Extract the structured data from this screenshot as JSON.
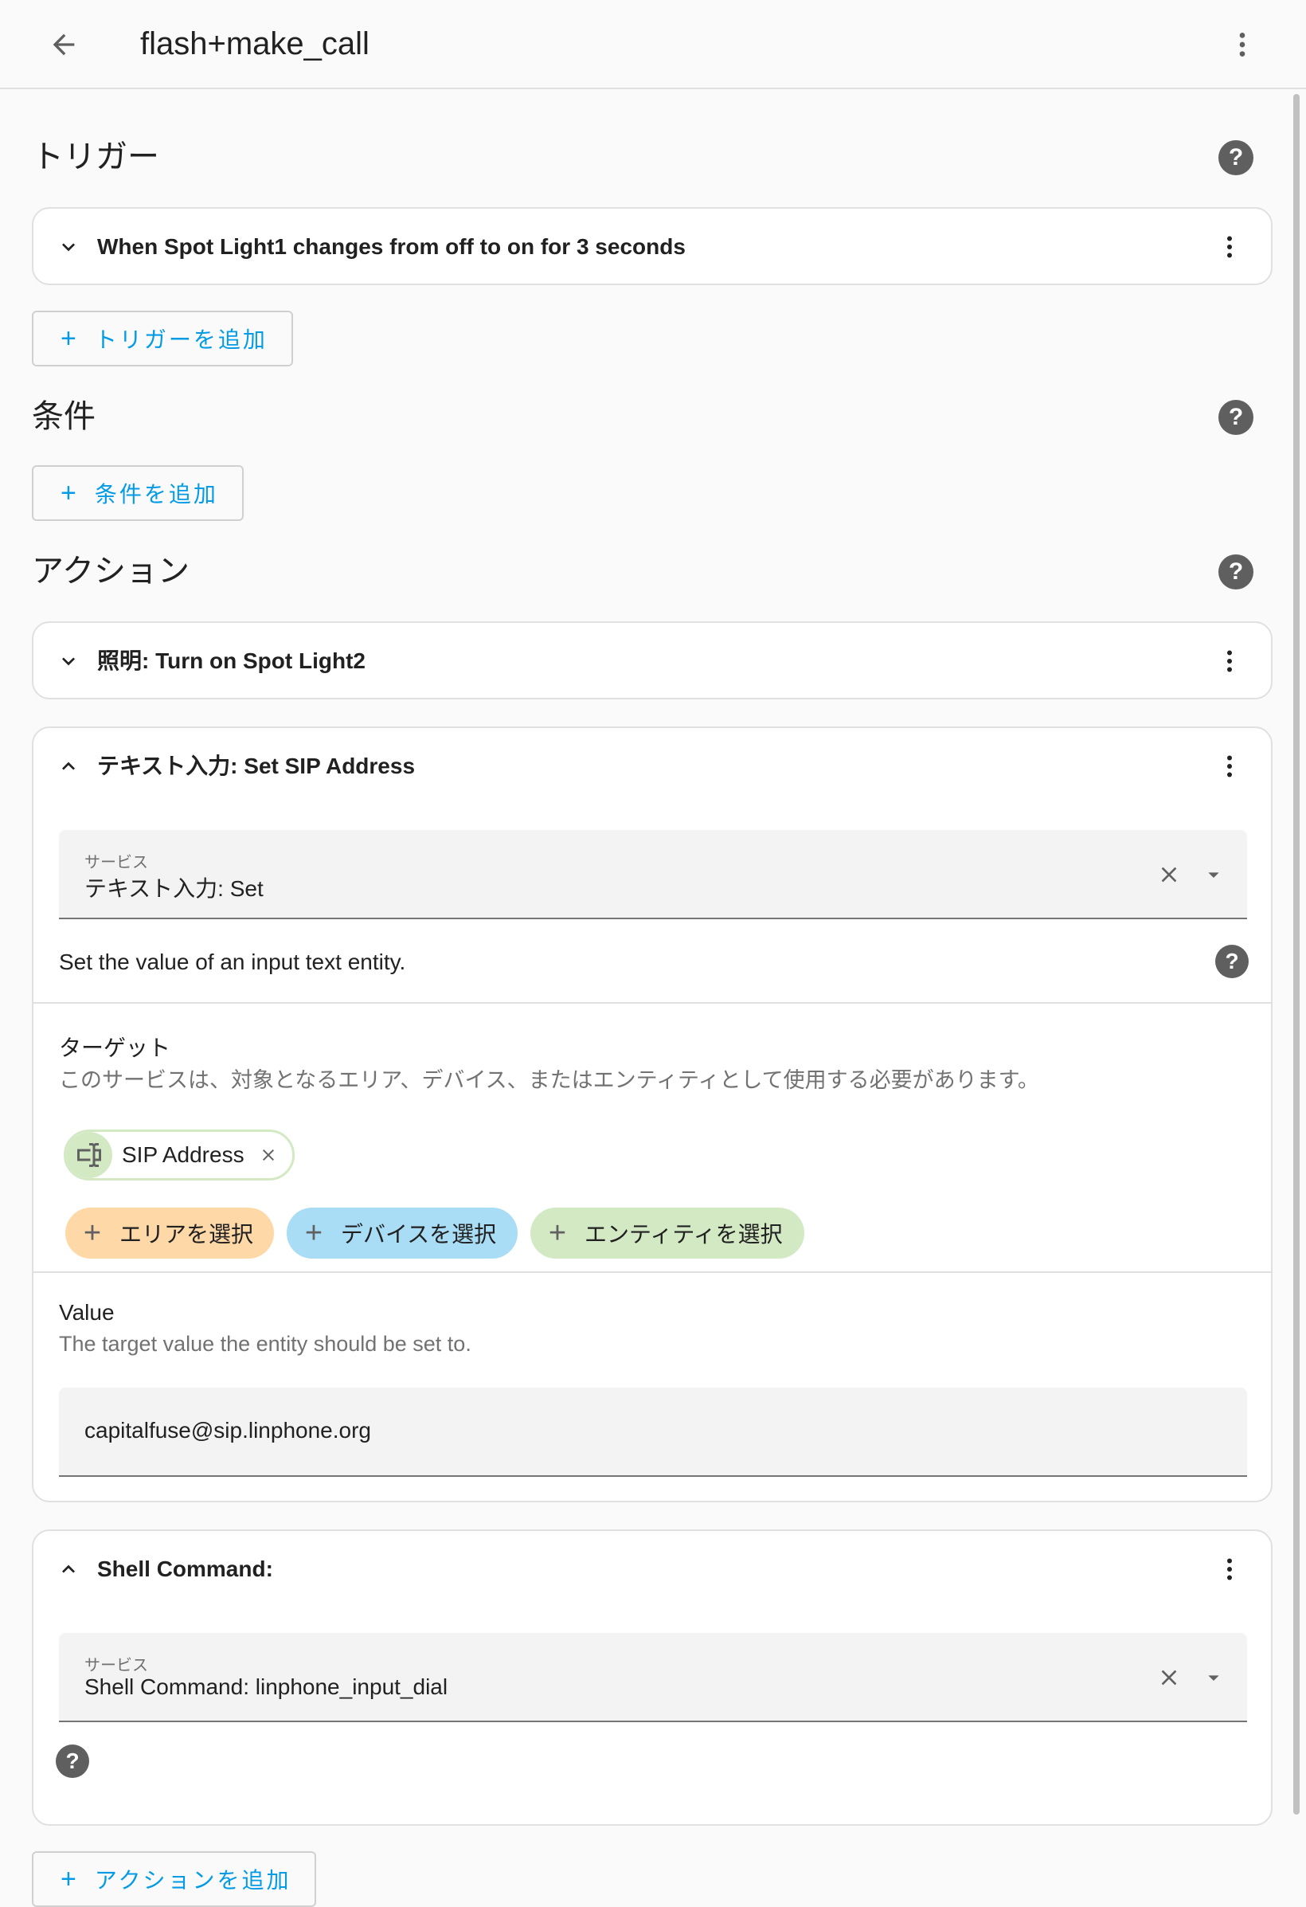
{
  "header": {
    "title": "flash+make_call"
  },
  "triggers": {
    "section_title": "トリガー",
    "items": [
      {
        "title": "When Spot Light1 changes from off to on for 3 seconds"
      }
    ],
    "add_label": "トリガーを追加"
  },
  "conditions": {
    "section_title": "条件",
    "add_label": "条件を追加"
  },
  "actions": {
    "section_title": "アクション",
    "items": [
      {
        "title": "照明: Turn on Spot Light2"
      },
      {
        "title": "テキスト入力: Set SIP Address",
        "service_label": "サービス",
        "service_value": "テキスト入力: Set",
        "description": "Set the value of an input text entity.",
        "target_title": "ターゲット",
        "target_description": "このサービスは、対象となるエリア、デバイス、またはエンティティとして使用する必要があります。",
        "selected_entity": "SIP Address",
        "pick_area": "エリアを選択",
        "pick_device": "デバイスを選択",
        "pick_entity": "エンティティを選択",
        "value_title": "Value",
        "value_description": "The target value the entity should be set to.",
        "value": "capitalfuse@sip.linphone.org"
      },
      {
        "title": "Shell Command:",
        "service_label": "サービス",
        "service_value": "Shell Command: linphone_input_dial"
      }
    ],
    "add_label": "アクションを追加"
  },
  "colors": {
    "accent": "#039be5",
    "area_chip": "#ffd8a8",
    "device_chip": "#a9dcf5",
    "entity_chip": "#d3e9c4"
  },
  "icons": [
    "arrow-left-icon",
    "dots-vertical-icon",
    "help-circle-icon",
    "chevron-down-icon",
    "chevron-up-icon",
    "close-icon",
    "menu-down-icon",
    "plus-icon",
    "form-textbox-icon"
  ]
}
